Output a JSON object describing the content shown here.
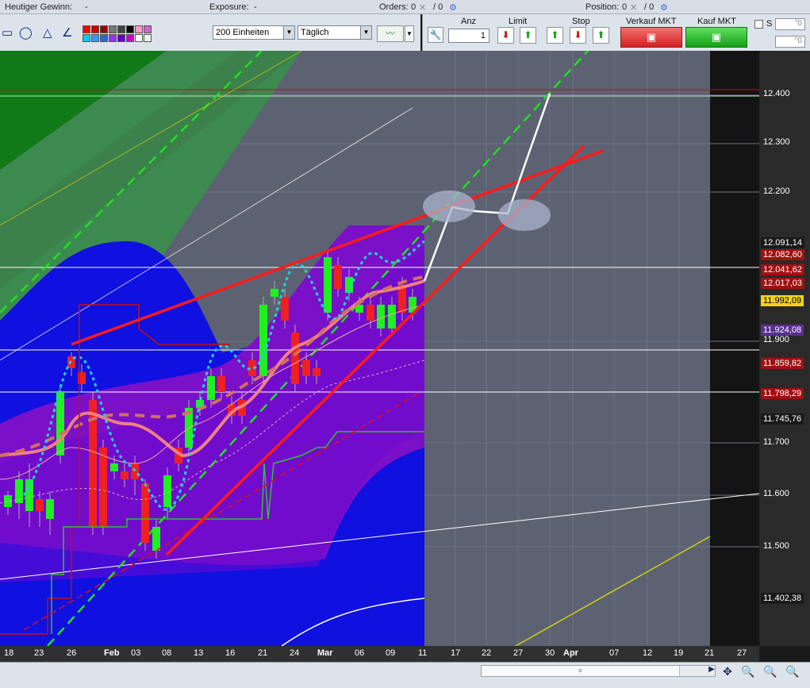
{
  "status": {
    "profit_label": "Heutiger Gewinn:",
    "profit_value": "-",
    "exposure_label": "Exposure:",
    "exposure_value": "-",
    "orders_label": "Orders:",
    "orders_value": "0",
    "orders_sep": "/ 0",
    "position_label": "Position:",
    "position_value": "0",
    "position_sep": "/ 0"
  },
  "toolbar": {
    "units": "200 Einheiten",
    "period": "Täglich",
    "colors": [
      "#ff0000",
      "#cc0000",
      "#990000",
      "#777777",
      "#444444",
      "#000000",
      "#ff99cc",
      "#cc66cc",
      "#00ccff",
      "#3399ff",
      "#3366cc",
      "#9933ff",
      "#6600cc",
      "#cc00cc",
      "#ffffff",
      "#eeeeee"
    ]
  },
  "trade": {
    "qty_label": "Anz",
    "qty_value": "1",
    "limit_label": "Limit",
    "stop_label": "Stop",
    "sell_label": "Verkauf MKT",
    "buy_label": "Kauf MKT",
    "s_label": "S"
  },
  "yaxis": {
    "ticks": [
      "12.400",
      "12.300",
      "12.200",
      "11.900",
      "11.700",
      "11.600",
      "11.500"
    ],
    "tags": [
      {
        "text": "12.091,14",
        "bg": "#1a1a1a"
      },
      {
        "text": "12.082,60",
        "bg": "#a01010"
      },
      {
        "text": "12.041,62",
        "bg": "#a01010"
      },
      {
        "text": "12.017,03",
        "bg": "#a01010"
      },
      {
        "text": "11.992,09",
        "bg": "#f0d020"
      },
      {
        "text": "11.924,08",
        "bg": "#5a3090"
      },
      {
        "text": "11.859,82",
        "bg": "#a01010"
      },
      {
        "text": "11.798,29",
        "bg": "#a01010"
      },
      {
        "text": "11.745,76",
        "bg": "#1a1a1a"
      },
      {
        "text": "11.402,38",
        "bg": "#1a1a1a"
      }
    ]
  },
  "xaxis": {
    "labels": [
      "18",
      "23",
      "26",
      "Feb",
      "03",
      "08",
      "13",
      "16",
      "21",
      "24",
      "Mar",
      "06",
      "09",
      "11",
      "17",
      "22",
      "27",
      "30",
      "Apr",
      "07",
      "12",
      "19",
      "21",
      "27"
    ]
  }
}
